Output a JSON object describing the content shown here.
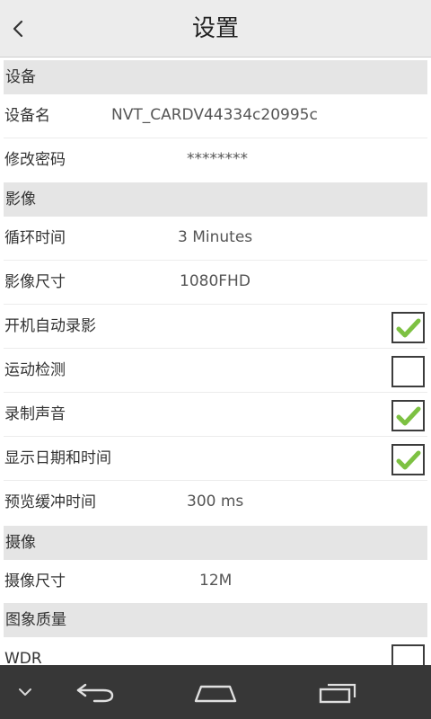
{
  "header": {
    "title": "设置"
  },
  "sections": {
    "device": "设备",
    "video": "影像",
    "photo": "摄像",
    "quality": "图象质量"
  },
  "rows": {
    "device_name": {
      "label": "设备名",
      "value": "NVT_CARDV44334c20995c"
    },
    "change_password": {
      "label": "修改密码",
      "value": "********"
    },
    "loop_time": {
      "label": "循环时间",
      "value": "3 Minutes"
    },
    "video_size": {
      "label": "影像尺寸",
      "value": "1080FHD"
    },
    "auto_record": {
      "label": "开机自动录影",
      "checked": true
    },
    "motion_detect": {
      "label": "运动检测",
      "checked": false
    },
    "record_audio": {
      "label": "录制声音",
      "checked": true
    },
    "show_datetime": {
      "label": "显示日期和时间",
      "checked": true
    },
    "preview_buffer": {
      "label": "预览缓冲时间",
      "value": "300 ms"
    },
    "photo_size": {
      "label": "摄像尺寸",
      "value": "12M"
    },
    "wdr": {
      "label": "WDR",
      "checked": false
    }
  },
  "icons": {
    "back": "chevron-left-icon",
    "check": "checkmark-icon",
    "nav_down": "chevron-down-icon",
    "nav_back": "back-arrow-icon",
    "nav_home": "home-icon",
    "nav_recents": "recent-apps-icon"
  },
  "colors": {
    "check_green": "#7dc142",
    "navbar": "#373737",
    "section_bg": "#e5e5e5"
  }
}
